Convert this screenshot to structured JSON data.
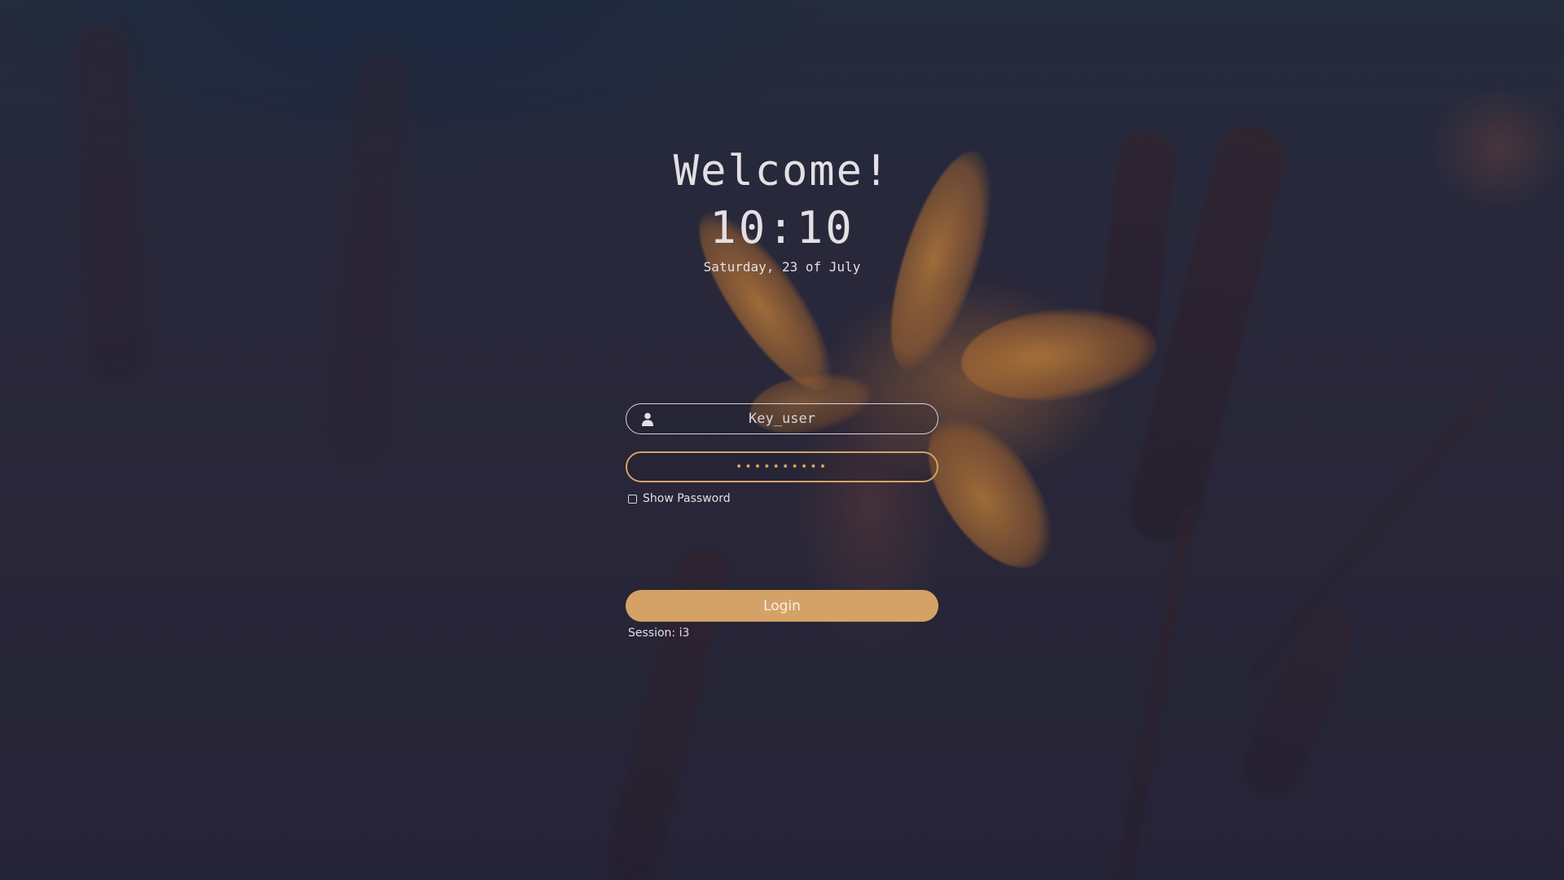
{
  "greeter": {
    "welcome": "Welcome!",
    "time": "10:10",
    "date": "Saturday, 23 of July"
  },
  "login_form": {
    "username_value": "Key_user",
    "username_icon": "user-icon",
    "password_value": "••••••••••",
    "show_password_label": "Show Password",
    "show_password_checked": false,
    "login_label": "Login",
    "session_label": "Session: i3"
  },
  "colors": {
    "accent": "#d4a266",
    "text": "#e4dfe3",
    "background": "#2a2837"
  }
}
